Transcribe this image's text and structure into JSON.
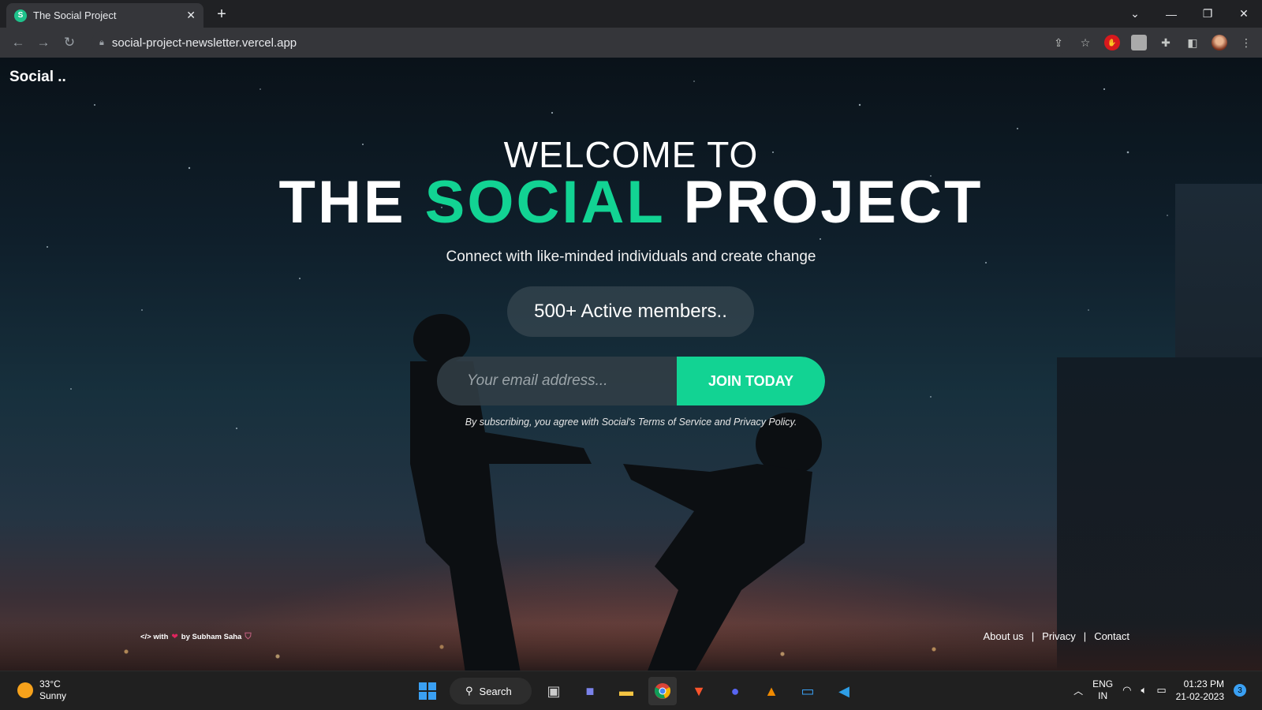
{
  "browser": {
    "tab_title": "The Social Project",
    "favicon_letter": "S",
    "url": "social-project-newsletter.vercel.app"
  },
  "page": {
    "brand": "Social ..",
    "welcome": "WELCOME TO",
    "headline_part1": "THE",
    "headline_accent": "SOCIAL",
    "headline_part2": "PROJECT",
    "subtitle": "Connect with like-minded individuals and create change",
    "members": "500+ Active members..",
    "email_placeholder": "Your email address...",
    "join_label": "JOIN TODAY",
    "terms": "By subscribing, you agree with Social's Terms of Service and Privacy Policy.",
    "credit_code": "</> with",
    "credit_by": "by Subham Saha",
    "footer": {
      "about": "About us",
      "privacy": "Privacy",
      "contact": "Contact",
      "separator": "|"
    },
    "accent_color": "#12d393"
  },
  "taskbar": {
    "temperature": "33°C",
    "condition": "Sunny",
    "search_label": "Search",
    "lang_top": "ENG",
    "lang_bottom": "IN",
    "time": "01:23 PM",
    "date": "21-02-2023",
    "notification_count": "3"
  }
}
